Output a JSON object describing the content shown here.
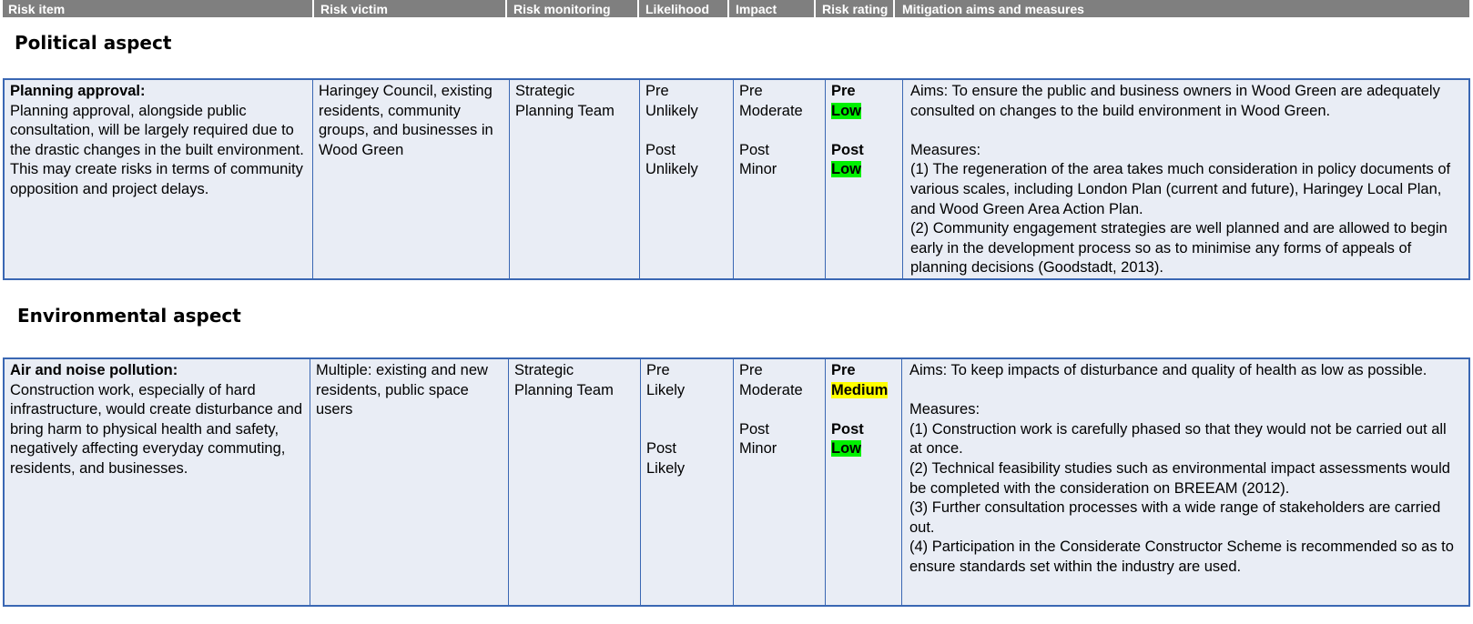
{
  "header": {
    "columns": [
      "Risk item",
      "Risk victim",
      "Risk monitoring",
      "Likelihood",
      "Impact",
      "Risk rating",
      "Mitigation aims and measures"
    ]
  },
  "sections": [
    {
      "title": "Political aspect",
      "row": {
        "risk_item_title": "Planning approval:",
        "risk_item_text": "Planning approval, alongside public consultation, will be largely required due to the drastic changes in the built environment. This may create risks in terms of community opposition and project delays.",
        "victim": "Haringey Council, existing residents, community groups, and businesses in Wood Green",
        "monitoring": "Strategic Planning Team",
        "likelihood_pre_label": "Pre",
        "likelihood_pre": "Unlikely",
        "likelihood_post_label": "Post",
        "likelihood_post": "Unlikely",
        "impact_pre_label": "Pre",
        "impact_pre": "Moderate",
        "impact_post_label": "Post",
        "impact_post": "Minor",
        "rating_pre_label": "Pre",
        "rating_pre": "Low",
        "rating_post_label": "Post",
        "rating_post": "Low",
        "aims": "Aims: To ensure the public and business owners in Wood Green are adequately consulted on changes to the build environment in Wood Green.",
        "measures_label": "Measures:",
        "measures": [
          "(1) The regeneration of the area takes much consideration in policy documents of various scales, including London Plan (current and future), Haringey Local Plan, and Wood Green Area Action Plan.",
          "(2) Community engagement strategies are well planned and are allowed to begin early in the development process so as to minimise any forms of appeals of planning decisions (Goodstadt, 2013)."
        ]
      }
    },
    {
      "title": "Environmental aspect",
      "row": {
        "risk_item_title": "Air and noise pollution:",
        "risk_item_text": "Construction work, especially of hard infrastructure, would create disturbance and bring harm to physical health and safety, negatively affecting everyday commuting, residents, and businesses.",
        "victim": "Multiple: existing and new residents, public space users",
        "monitoring": "Strategic Planning Team",
        "likelihood_pre_label": "Pre",
        "likelihood_pre": "Likely",
        "likelihood_post_label": "Post",
        "likelihood_post": "Likely",
        "impact_pre_label": "Pre",
        "impact_pre": "Moderate",
        "impact_post_label": "Post",
        "impact_post": "Minor",
        "rating_pre_label": "Pre",
        "rating_pre": "Medium",
        "rating_post_label": "Post",
        "rating_post": "Low",
        "aims": "Aims: To keep impacts of disturbance and quality of health as low as possible.",
        "measures_label": "Measures:",
        "measures": [
          "(1) Construction work is carefully phased so that they would not be carried out all at once.",
          "(2) Technical feasibility studies such as environmental impact assessments would be completed with the consideration on BREEAM (2012).",
          "(3) Further consultation processes with a wide range of stakeholders are carried out.",
          "(4) Participation in the Considerate Constructor Scheme is recommended so as to ensure standards set within the industry are used."
        ]
      }
    }
  ],
  "colors": {
    "header_bg": "#7f7f7f",
    "row_bg": "#e9edf5",
    "border": "#3a67b3",
    "low": "#00f000",
    "medium": "#ffff00"
  }
}
